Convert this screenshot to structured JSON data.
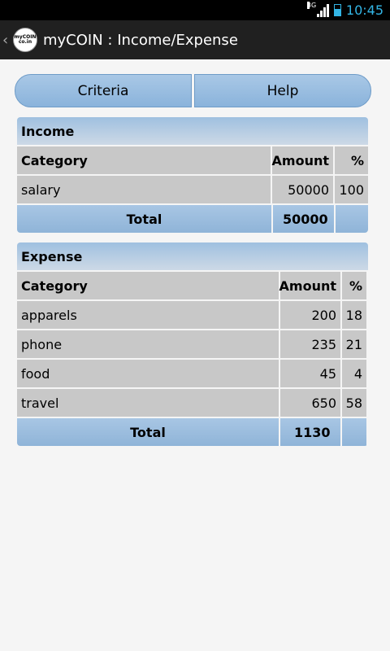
{
  "status_bar": {
    "network": "3G",
    "time": "10:45"
  },
  "app": {
    "logo_text": [
      "myCOIN",
      "co.in"
    ],
    "title": "myCOIN : Income/Expense"
  },
  "buttons": {
    "criteria": "Criteria",
    "help": "Help"
  },
  "income": {
    "title": "Income",
    "headers": [
      "Category",
      "Amount",
      "%"
    ],
    "rows": [
      {
        "category": "salary",
        "amount": "50000",
        "percent": "100"
      }
    ],
    "total_label": "Total",
    "total_amount": "50000",
    "total_percent": ""
  },
  "expense": {
    "title": "Expense",
    "headers": [
      "Category",
      "Amount",
      "%"
    ],
    "rows": [
      {
        "category": "apparels",
        "amount": "200",
        "percent": "18"
      },
      {
        "category": "phone",
        "amount": "235",
        "percent": "21"
      },
      {
        "category": "food",
        "amount": "45",
        "percent": "4"
      },
      {
        "category": "travel",
        "amount": "650",
        "percent": "58"
      }
    ],
    "total_label": "Total",
    "total_amount": "1130",
    "total_percent": ""
  }
}
